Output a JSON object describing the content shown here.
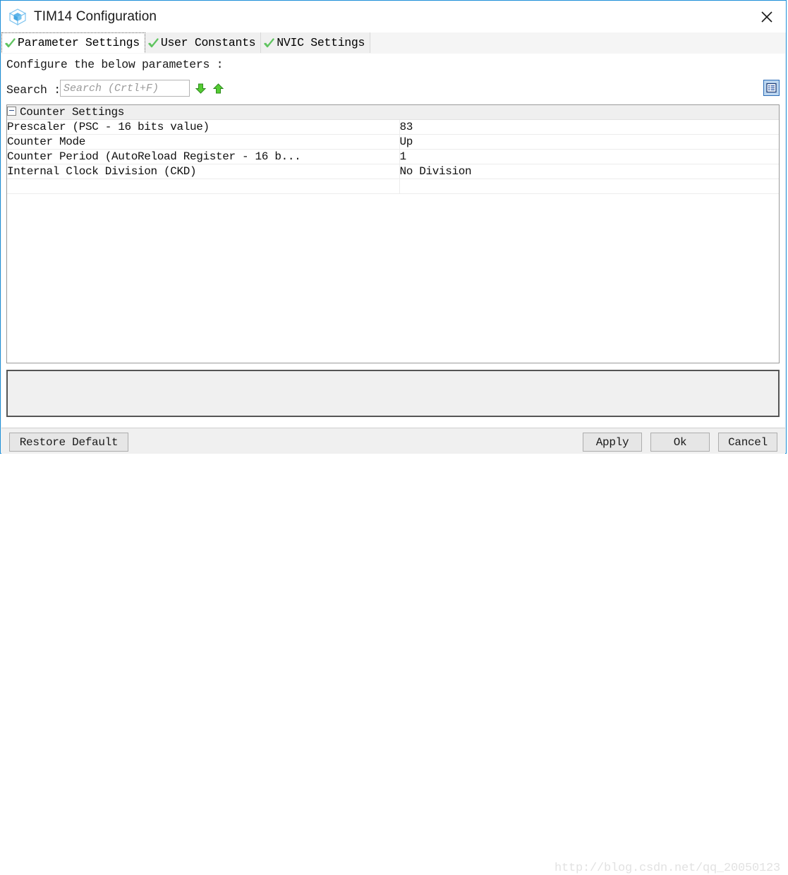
{
  "window": {
    "title": "TIM14 Configuration",
    "app_icon": "cube-icon",
    "close_icon": "close-icon",
    "border_color": "#1e90d8"
  },
  "tabs": [
    {
      "label": "Parameter Settings",
      "icon": "green-check-icon",
      "active": true
    },
    {
      "label": "User Constants",
      "icon": "green-check-icon",
      "active": false
    },
    {
      "label": "NVIC Settings",
      "icon": "green-check-icon",
      "active": false
    }
  ],
  "instruction": "Configure the below parameters :",
  "search": {
    "label": "Search :",
    "value": "",
    "placeholder": "Search (Crtl+F)",
    "next_icon": "arrow-down-icon",
    "prev_icon": "arrow-up-icon",
    "view_toggle_icon": "list-view-icon"
  },
  "table": {
    "group": {
      "label": "Counter Settings",
      "collapse_icon": "minus-box-icon",
      "expanded": true
    },
    "rows": [
      {
        "name": "Prescaler (PSC - 16 bits value)",
        "value": "83"
      },
      {
        "name": "Counter Mode",
        "value": "Up"
      },
      {
        "name": "Counter Period (AutoReload Register - 16 b...",
        "value": "1"
      },
      {
        "name": "Internal Clock Division (CKD)",
        "value": "No Division"
      }
    ]
  },
  "description_panel": {
    "text": ""
  },
  "footer": {
    "restore_label": "Restore Default",
    "apply_label": "Apply",
    "ok_label": "Ok",
    "cancel_label": "Cancel"
  },
  "watermark": "http://blog.csdn.net/qq_20050123"
}
